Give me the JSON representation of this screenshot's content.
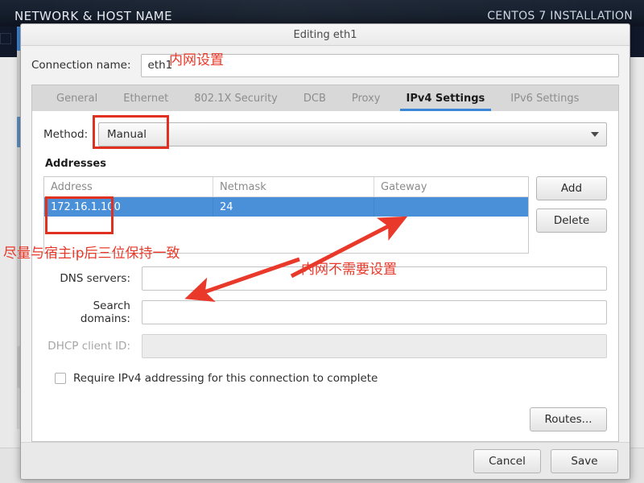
{
  "installer": {
    "screen_title": "NETWORK & HOST NAME",
    "product_label": "CENTOS 7 INSTALLATION"
  },
  "dialog": {
    "title": "Editing eth1",
    "connection_name_label": "Connection name:",
    "connection_name_value": "eth1",
    "tabs": [
      {
        "label": "General",
        "active": false
      },
      {
        "label": "Ethernet",
        "active": false
      },
      {
        "label": "802.1X Security",
        "active": false
      },
      {
        "label": "DCB",
        "active": false
      },
      {
        "label": "Proxy",
        "active": false
      },
      {
        "label": "IPv4 Settings",
        "active": true
      },
      {
        "label": "IPv6 Settings",
        "active": false
      }
    ],
    "method_label": "Method:",
    "method_value": "Manual",
    "addresses_section_title": "Addresses",
    "address_columns": [
      "Address",
      "Netmask",
      "Gateway"
    ],
    "address_rows": [
      {
        "address": "172.16.1.100",
        "netmask": "24",
        "gateway": ""
      }
    ],
    "add_button": "Add",
    "delete_button": "Delete",
    "dns_label": "DNS servers:",
    "dns_value": "",
    "search_domains_label": "Search domains:",
    "search_domains_value": "",
    "dhcp_client_id_label": "DHCP client ID:",
    "dhcp_client_id_value": "",
    "require_ipv4_label": "Require IPv4 addressing for this connection to complete",
    "routes_button": "Routes...",
    "cancel_button": "Cancel",
    "save_button": "Save"
  },
  "annotations": [
    {
      "text": "内网设置"
    },
    {
      "text": "尽量与宿主ip后三位保持一致"
    },
    {
      "text": "内网不需要设置"
    }
  ],
  "colors": {
    "annotation_red": "#e8392a",
    "selection_blue": "#4a90d9",
    "tab_accent": "#3c86d8",
    "installer_header": "#141d2b"
  }
}
